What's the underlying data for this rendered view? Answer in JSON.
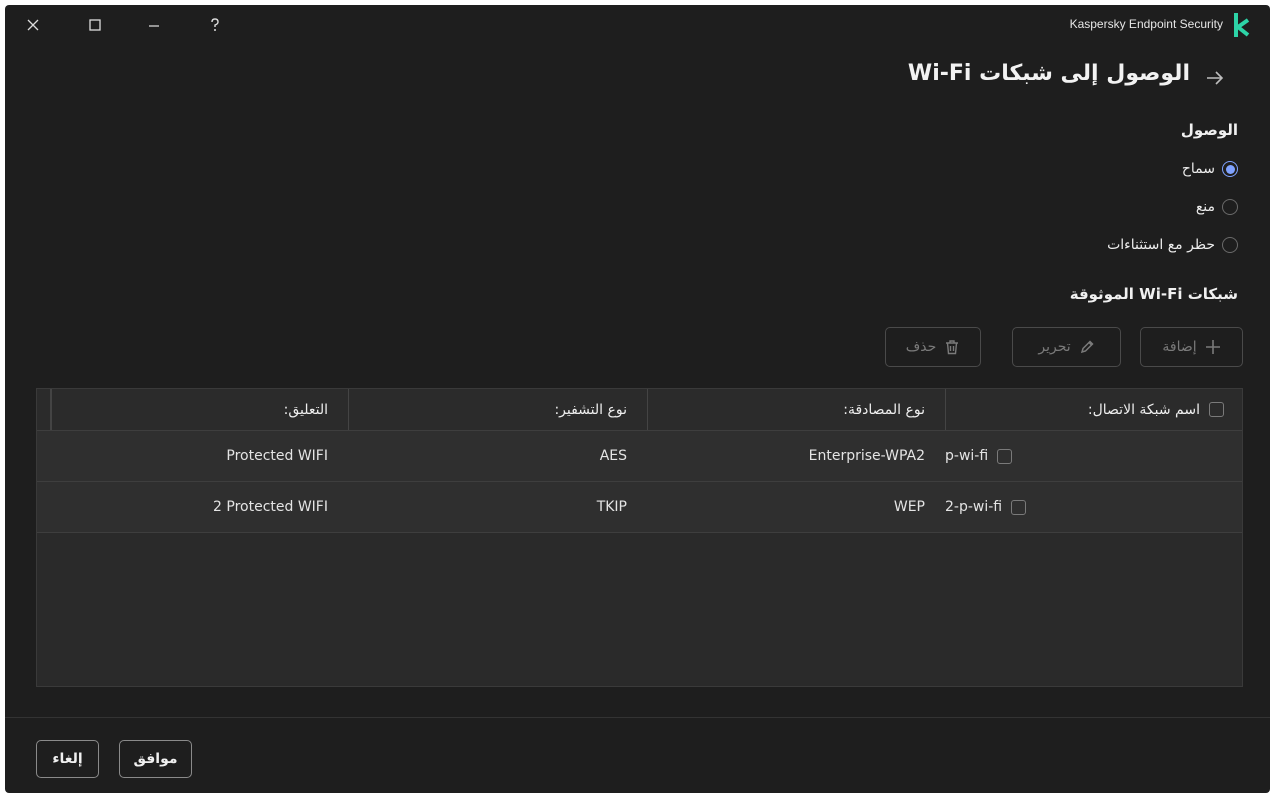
{
  "window": {
    "app_name": "Kaspersky Endpoint Security",
    "logo_letter": "k",
    "accent": "#2dd4a7"
  },
  "header": {
    "title": "الوصول إلى شبكات Wi-Fi"
  },
  "access": {
    "label": "الوصول",
    "options": [
      {
        "label": "سماح",
        "selected": true
      },
      {
        "label": "منع",
        "selected": false
      },
      {
        "label": "حظر مع استثناءات",
        "selected": false
      }
    ]
  },
  "trusted": {
    "label": "شبكات Wi-Fi الموثوقة",
    "toolbar": {
      "add_label": "إضافة",
      "edit_label": "تحرير",
      "delete_label": "حذف"
    }
  },
  "table": {
    "columns": [
      "اسم شبكة الاتصال:",
      "نوع المصادقة:",
      "نوع التشفير:",
      "التعليق:"
    ],
    "rows": [
      {
        "name": "p-wi-fi",
        "auth": "Enterprise-WPA2",
        "encryption": "AES",
        "comment": "Protected WIFI"
      },
      {
        "name": "2-p-wi-fi",
        "auth": "WEP",
        "encryption": "TKIP",
        "comment": "2 Protected WIFI"
      }
    ]
  },
  "footer": {
    "ok_label": "موافق",
    "cancel_label": "إلغاء"
  },
  "colors": {
    "background": "#1e1e1e",
    "radio_accent": "#7fa2ff",
    "disabled_text": "#7a7a7a"
  }
}
